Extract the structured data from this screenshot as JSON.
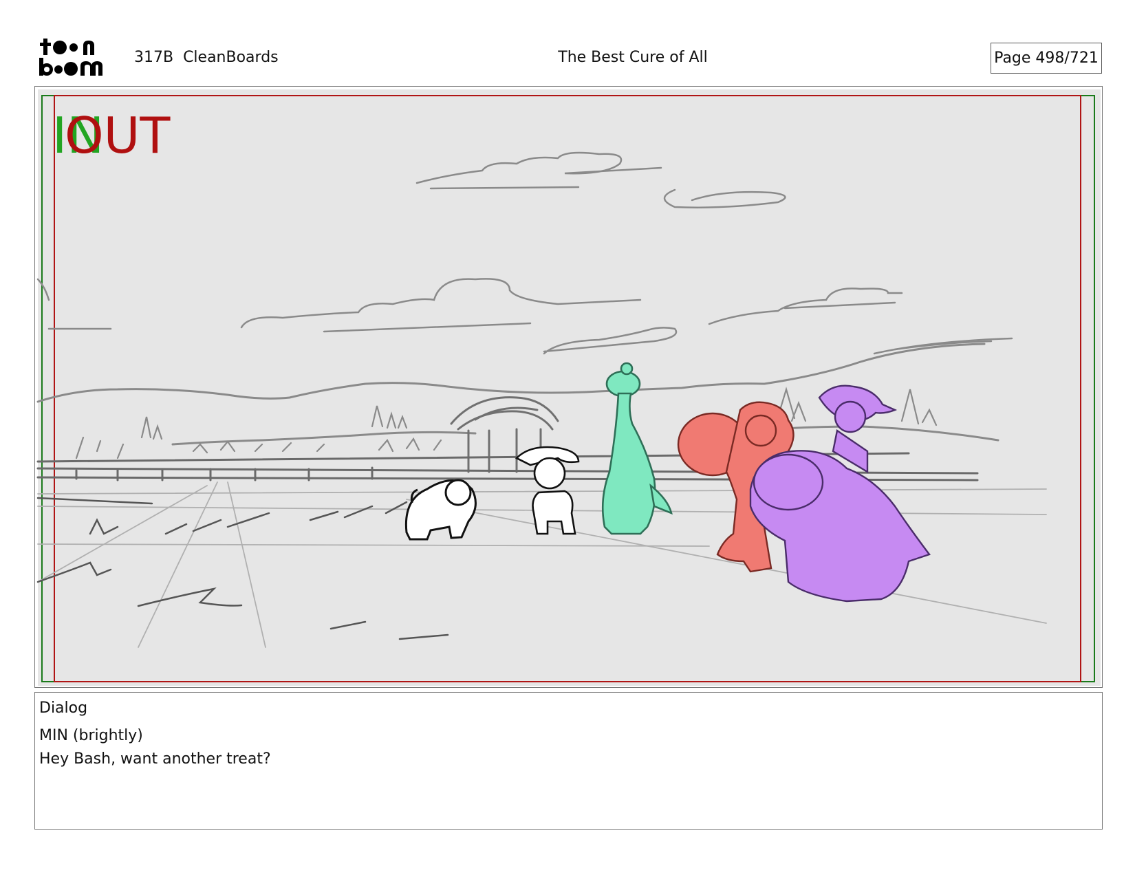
{
  "header": {
    "logo_text": "toonboom",
    "project": "317B  CleanBoards",
    "title": "The Best Cure of All",
    "page_label": "Page 498/721"
  },
  "panel": {
    "in_marker": "IN",
    "out_marker": "OUT",
    "colors": {
      "in_frame": "#1a7a1a",
      "out_frame": "#b01515",
      "in_text": "#22a522",
      "out_text": "#b01010",
      "background": "#e6e6e6",
      "sketch": "#8a8a8a",
      "dino_green": "#7fe8c0",
      "char_red": "#f07a72",
      "char_purple": "#c68af2"
    }
  },
  "dialog": {
    "heading": "Dialog",
    "speaker": "MIN (brightly)",
    "line": "Hey Bash, want another treat?"
  }
}
